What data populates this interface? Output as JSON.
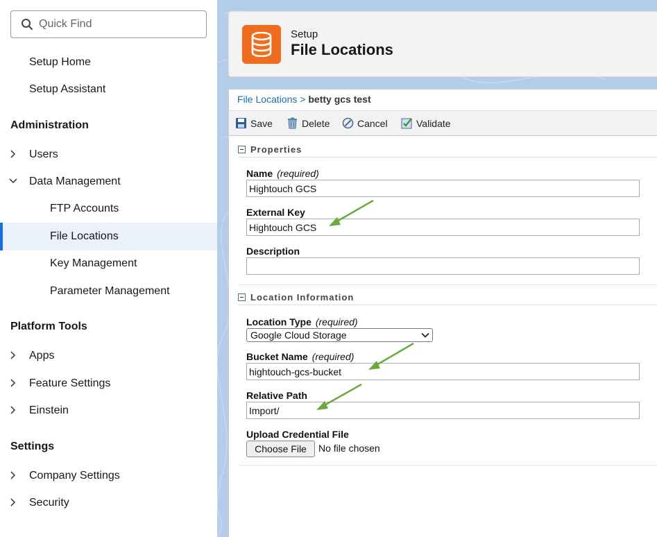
{
  "sidebar": {
    "quick_find_placeholder": "Quick Find",
    "top_items": [
      "Setup Home",
      "Setup Assistant"
    ],
    "sections": {
      "administration": "Administration",
      "platform_tools": "Platform Tools",
      "settings": "Settings"
    },
    "admin_items": {
      "users": "Users",
      "data_management": "Data Management",
      "ftp_accounts": "FTP Accounts",
      "file_locations": "File Locations",
      "key_management": "Key Management",
      "parameter_management": "Parameter Management"
    },
    "platform_items": {
      "apps": "Apps",
      "feature_settings": "Feature Settings",
      "einstein": "Einstein"
    },
    "settings_items": {
      "company_settings": "Company Settings",
      "security": "Security"
    },
    "active_item": "File Locations"
  },
  "header": {
    "subtitle": "Setup",
    "title": "File Locations",
    "icon": "database-icon",
    "icon_color": "#f06d1f"
  },
  "breadcrumb": {
    "parent": "File Locations",
    "separator": " > ",
    "current": "betty gcs test"
  },
  "toolbar": {
    "save": "Save",
    "delete": "Delete",
    "cancel": "Cancel",
    "validate": "Validate"
  },
  "properties": {
    "section_title": "Properties",
    "name_label": "Name",
    "name_required": "(required)",
    "name_value": "Hightouch GCS",
    "external_key_label": "External Key",
    "external_key_value": "Hightouch GCS",
    "description_label": "Description",
    "description_value": ""
  },
  "location": {
    "section_title": "Location Information",
    "type_label": "Location Type",
    "type_required": "(required)",
    "type_value": "Google Cloud Storage",
    "bucket_label": "Bucket Name",
    "bucket_required": "(required)",
    "bucket_value": "hightouch-gcs-bucket",
    "path_label": "Relative Path",
    "path_value": "Import/",
    "credential_label": "Upload Credential File",
    "choose_file": "Choose File",
    "no_file": "No file chosen"
  },
  "colors": {
    "accent": "#1b6fd8",
    "annotation_arrow": "#6aaa3a",
    "background_blue": "#b3cde8"
  }
}
